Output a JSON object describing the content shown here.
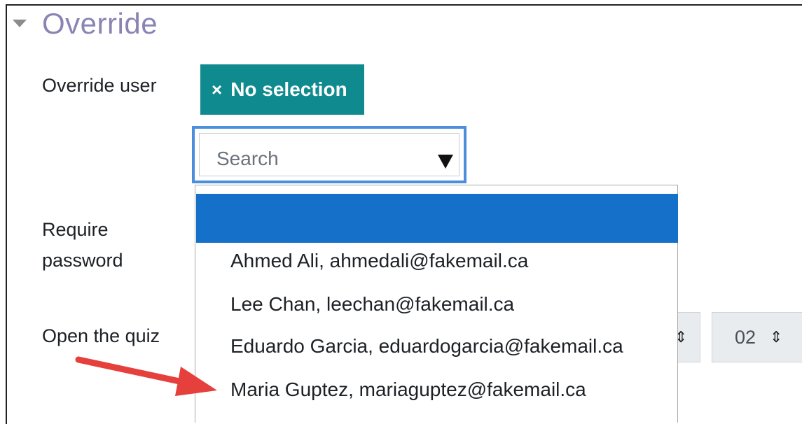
{
  "section": {
    "title": "Override"
  },
  "labels": {
    "override_user": "Override user",
    "require": "Require",
    "password": "password",
    "open_quiz": "Open the quiz"
  },
  "chip": {
    "icon": "×",
    "label": "No selection"
  },
  "search": {
    "placeholder": "Search"
  },
  "dropdown": {
    "options": [
      "",
      "Ahmed Ali, ahmedali@fakemail.ca",
      "Lee Chan, leechan@fakemail.ca",
      "Eduardo Garcia, eduardogarcia@fakemail.ca",
      "Maria Guptez, mariaguptez@fakemail.ca"
    ]
  },
  "time_select": {
    "minute_value": "02",
    "updown_icon": "⇕"
  },
  "colors": {
    "accent": "#0f8a8f",
    "highlight": "#1470c8",
    "focus_border": "#4a8edc",
    "title": "#8a84b4",
    "annotation_arrow": "#e5403b"
  }
}
